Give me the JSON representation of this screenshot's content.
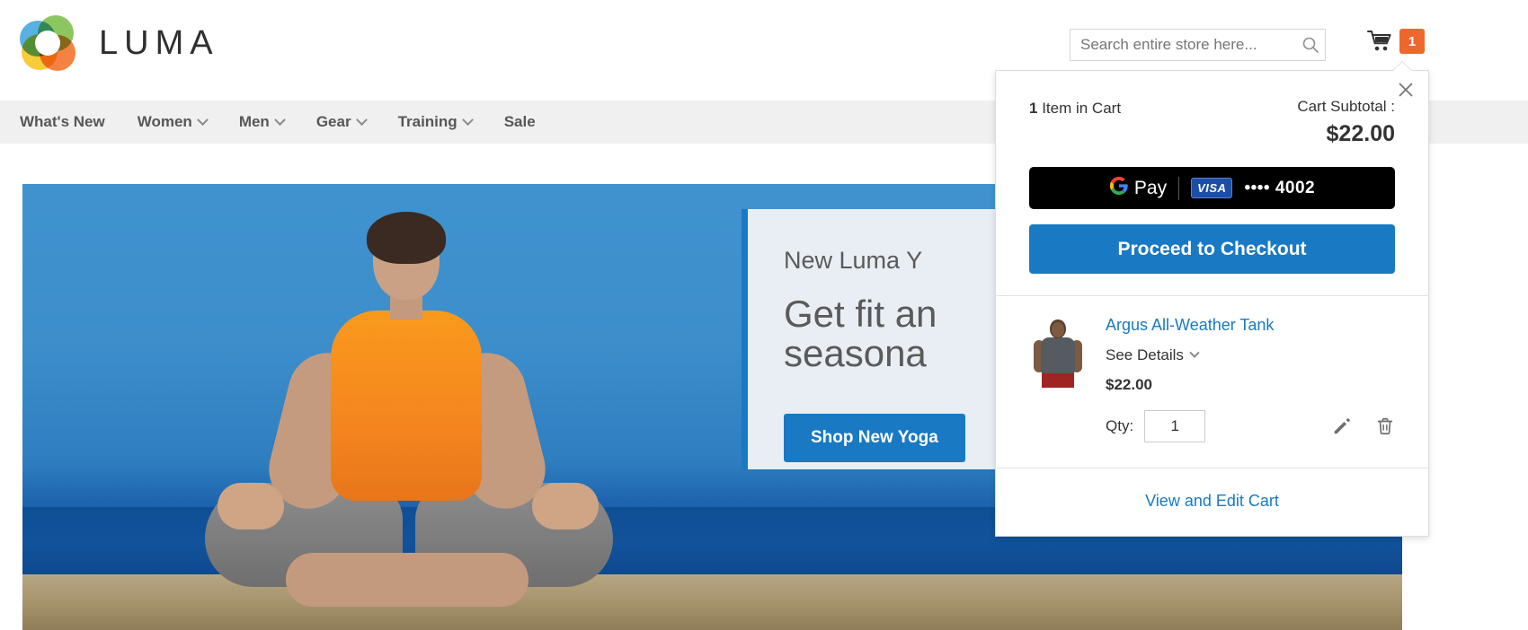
{
  "header": {
    "brand": "LUMA",
    "logo_icon": "luma-circles-logo",
    "search": {
      "placeholder": "Search entire store here...",
      "value": "",
      "icon": "search-icon"
    },
    "cart": {
      "icon": "shopping-cart-icon",
      "badge_count": "1"
    }
  },
  "nav": {
    "items": [
      {
        "label": "What's New",
        "has_dropdown": false
      },
      {
        "label": "Women",
        "has_dropdown": true
      },
      {
        "label": "Men",
        "has_dropdown": true
      },
      {
        "label": "Gear",
        "has_dropdown": true
      },
      {
        "label": "Training",
        "has_dropdown": true
      },
      {
        "label": "Sale",
        "has_dropdown": false
      }
    ]
  },
  "hero": {
    "eyebrow": "New Luma Y",
    "title": "Get fit an\nseasona",
    "button_label": "Shop New Yoga",
    "image_alt": "woman-meditating-on-beach"
  },
  "minicart": {
    "close_icon": "close-icon",
    "items_count_number": "1",
    "items_count_text": " Item in Cart",
    "subtotal_label": "Cart Subtotal :",
    "subtotal_value": "$22.00",
    "gpay": {
      "logo_text": "Pay",
      "g_icon": "google-g-icon",
      "card_brand": "VISA",
      "card_digits": "•••• 4002"
    },
    "checkout_label": "Proceed to Checkout",
    "product": {
      "thumb_alt": "argus-all-weather-tank-thumbnail",
      "name": "Argus All-Weather Tank",
      "see_details_label": "See Details",
      "see_details_icon": "chevron-down-icon",
      "price": "$22.00",
      "qty_label": "Qty:",
      "qty_value": "1",
      "edit_icon": "pencil-edit-icon",
      "delete_icon": "trash-delete-icon"
    },
    "view_cart_label": "View and Edit Cart"
  },
  "colors": {
    "accent_blue": "#1979c3",
    "badge_orange": "#ee672f",
    "nav_bg": "#f0f0f0",
    "panel_bg": "#e8eef4",
    "gpay_black": "#000000",
    "visa_blue": "#1a4ea8"
  }
}
